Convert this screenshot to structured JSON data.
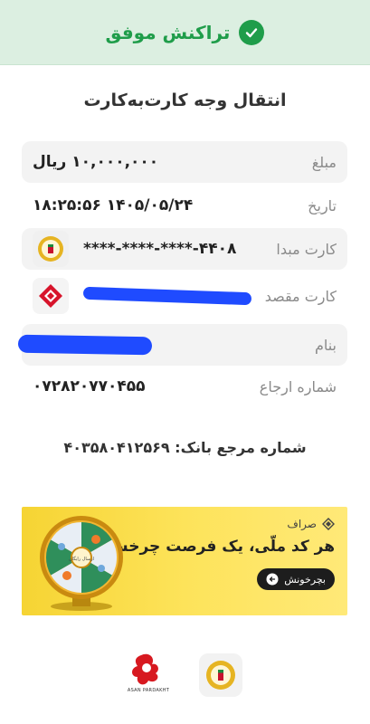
{
  "header": {
    "title": "تراکنش موفق",
    "color": "#1f9d4a",
    "background": "#dcefe1"
  },
  "card": {
    "title": "انتقال وجه کارت‌به‌کارت"
  },
  "rows": {
    "amount": {
      "label": "مبلغ",
      "value": "۱۰,۰۰۰,۰۰۰ ریال"
    },
    "date": {
      "label": "تاریخ",
      "value": "۱۸:۲۵:۵۶ ۱۴۰۵/۰۵/۲۴"
    },
    "source_card": {
      "label": "کارت مبدا",
      "value": "****-****-****-۴۴۰۸"
    },
    "dest_card": {
      "label": "کارت مقصد"
    },
    "name": {
      "label": "بنام"
    },
    "ref_number": {
      "label": "شماره ارجاع",
      "value": "۰۷۲۸۲۰۷۷۰۴۵۵"
    }
  },
  "bank_ref": {
    "text": "شماره مرجع بانک: ۴۰۳۵۸۰۴۱۲۵۶۹"
  },
  "banner": {
    "brand": "صراف",
    "headline": "هر کد ملّی، یک فرصت چرخش!",
    "button": "بچرخونش",
    "wheel_center": "ارسال رایگان"
  },
  "footer": {
    "asanpardakht": "ASAN PARDAKHT"
  }
}
